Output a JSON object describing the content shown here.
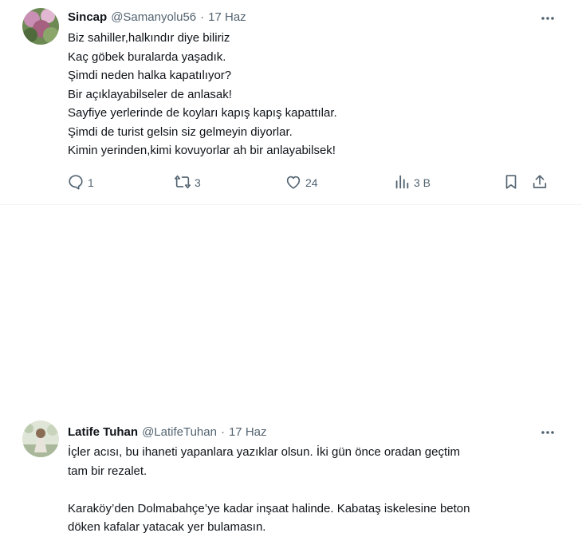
{
  "tweets": [
    {
      "author_name": "Sincap",
      "handle": "@Samanyolu56",
      "dot": "·",
      "date": "17 Haz",
      "lines": [
        "Biz sahiller,halkındır diye biliriz",
        "Kaç göbek buralarda yaşadık.",
        "Şimdi neden halka kapatılıyor?",
        "Bir açıklayabilseler de anlasak!",
        "Sayfiye yerlerinde de koyları kapış kapış kapattılar.",
        "Şimdi de turist gelsin siz gelmeyin diyorlar.",
        "Kimin yerinden,kimi kovuyorlar ah bir anlayabilsek!"
      ],
      "replies": "1",
      "retweets": "3",
      "likes": "24",
      "views": "3 B"
    },
    {
      "author_name": "Latife Tuhan",
      "handle": "@LatifeTuhan",
      "dot": "·",
      "date": "17 Haz",
      "lines": [
        "İçler acısı, bu ihaneti yapanlara yazıklar olsun. İki gün önce oradan geçtim",
        "tam bir rezalet.",
        "",
        "Karaköy’den Dolmabahçe’ye kadar inşaat halinde. Kabataş iskelesine beton",
        "döken kafalar yatacak yer bulamasın."
      ]
    }
  ],
  "colors": {
    "text": "#0f1419",
    "muted": "#536471",
    "divider": "#eff3f4"
  },
  "icons": [
    "more-icon",
    "reply-icon",
    "retweet-icon",
    "like-icon",
    "views-icon",
    "bookmark-icon",
    "share-icon"
  ]
}
